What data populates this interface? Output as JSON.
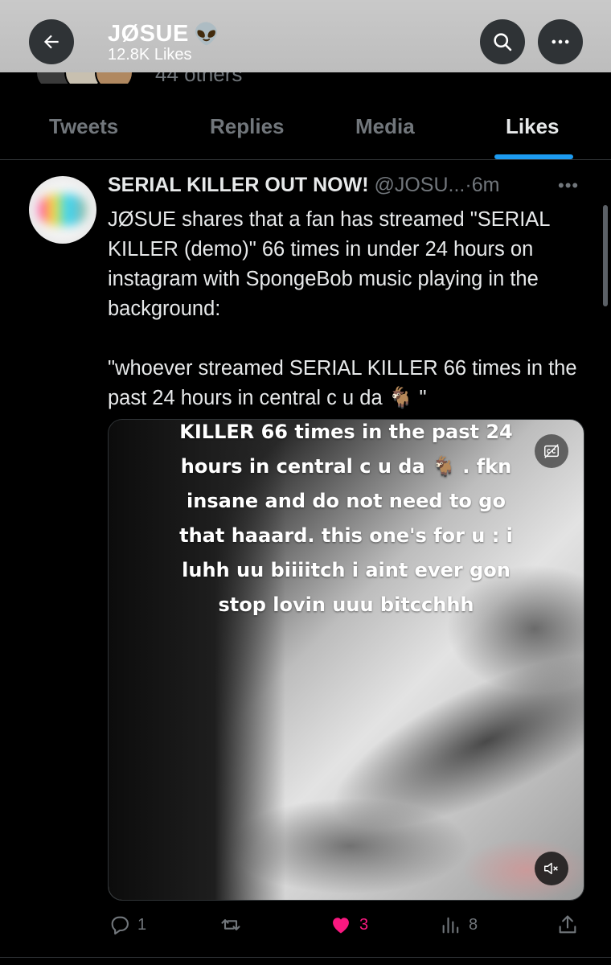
{
  "header": {
    "title": "JØSUE",
    "title_emoji": "👽",
    "subtitle": "12.8K Likes",
    "back_icon": "arrow-left-icon",
    "search_icon": "search-icon",
    "more_icon": "more-horizontal-icon"
  },
  "peek": {
    "text": "44 others"
  },
  "tabs": [
    {
      "label": "Tweets",
      "active": false
    },
    {
      "label": "Replies",
      "active": false
    },
    {
      "label": "Media",
      "active": false
    },
    {
      "label": "Likes",
      "active": true
    }
  ],
  "tweet": {
    "name": "SERIAL KILLER OUT NOW!",
    "handle": "@JOSU...",
    "separator": "·",
    "time": "6m",
    "more": "•••",
    "body_p1": "JØSUE shares that a fan has streamed \"SERIAL KILLER (demo)\" 66 times in under 24 hours on instagram with SpongeBob music playing in the background:",
    "body_p2": "\"whoever streamed SERIAL KILLER 66 times in the past 24 hours in central c u da 🐐 \"",
    "media": {
      "overlay_lines": [
        "KILLER 66 times in the past 24",
        "hours in central c u da 🐐 . fkn",
        "insane and do not need to go",
        "that haaard. this one's for u : i",
        "luhh uu biiiitch i aint ever gon",
        "stop lovin uuu bitcchhh"
      ],
      "cc_icon": "closed-captions-icon",
      "mute_icon": "volume-muted-icon"
    },
    "actions": {
      "replies": "1",
      "retweets": "",
      "likes": "3",
      "views": "8"
    }
  },
  "colors": {
    "background": "#000000",
    "accent": "#1d9bf0",
    "like": "#f91880",
    "muted_text": "#71767b"
  }
}
